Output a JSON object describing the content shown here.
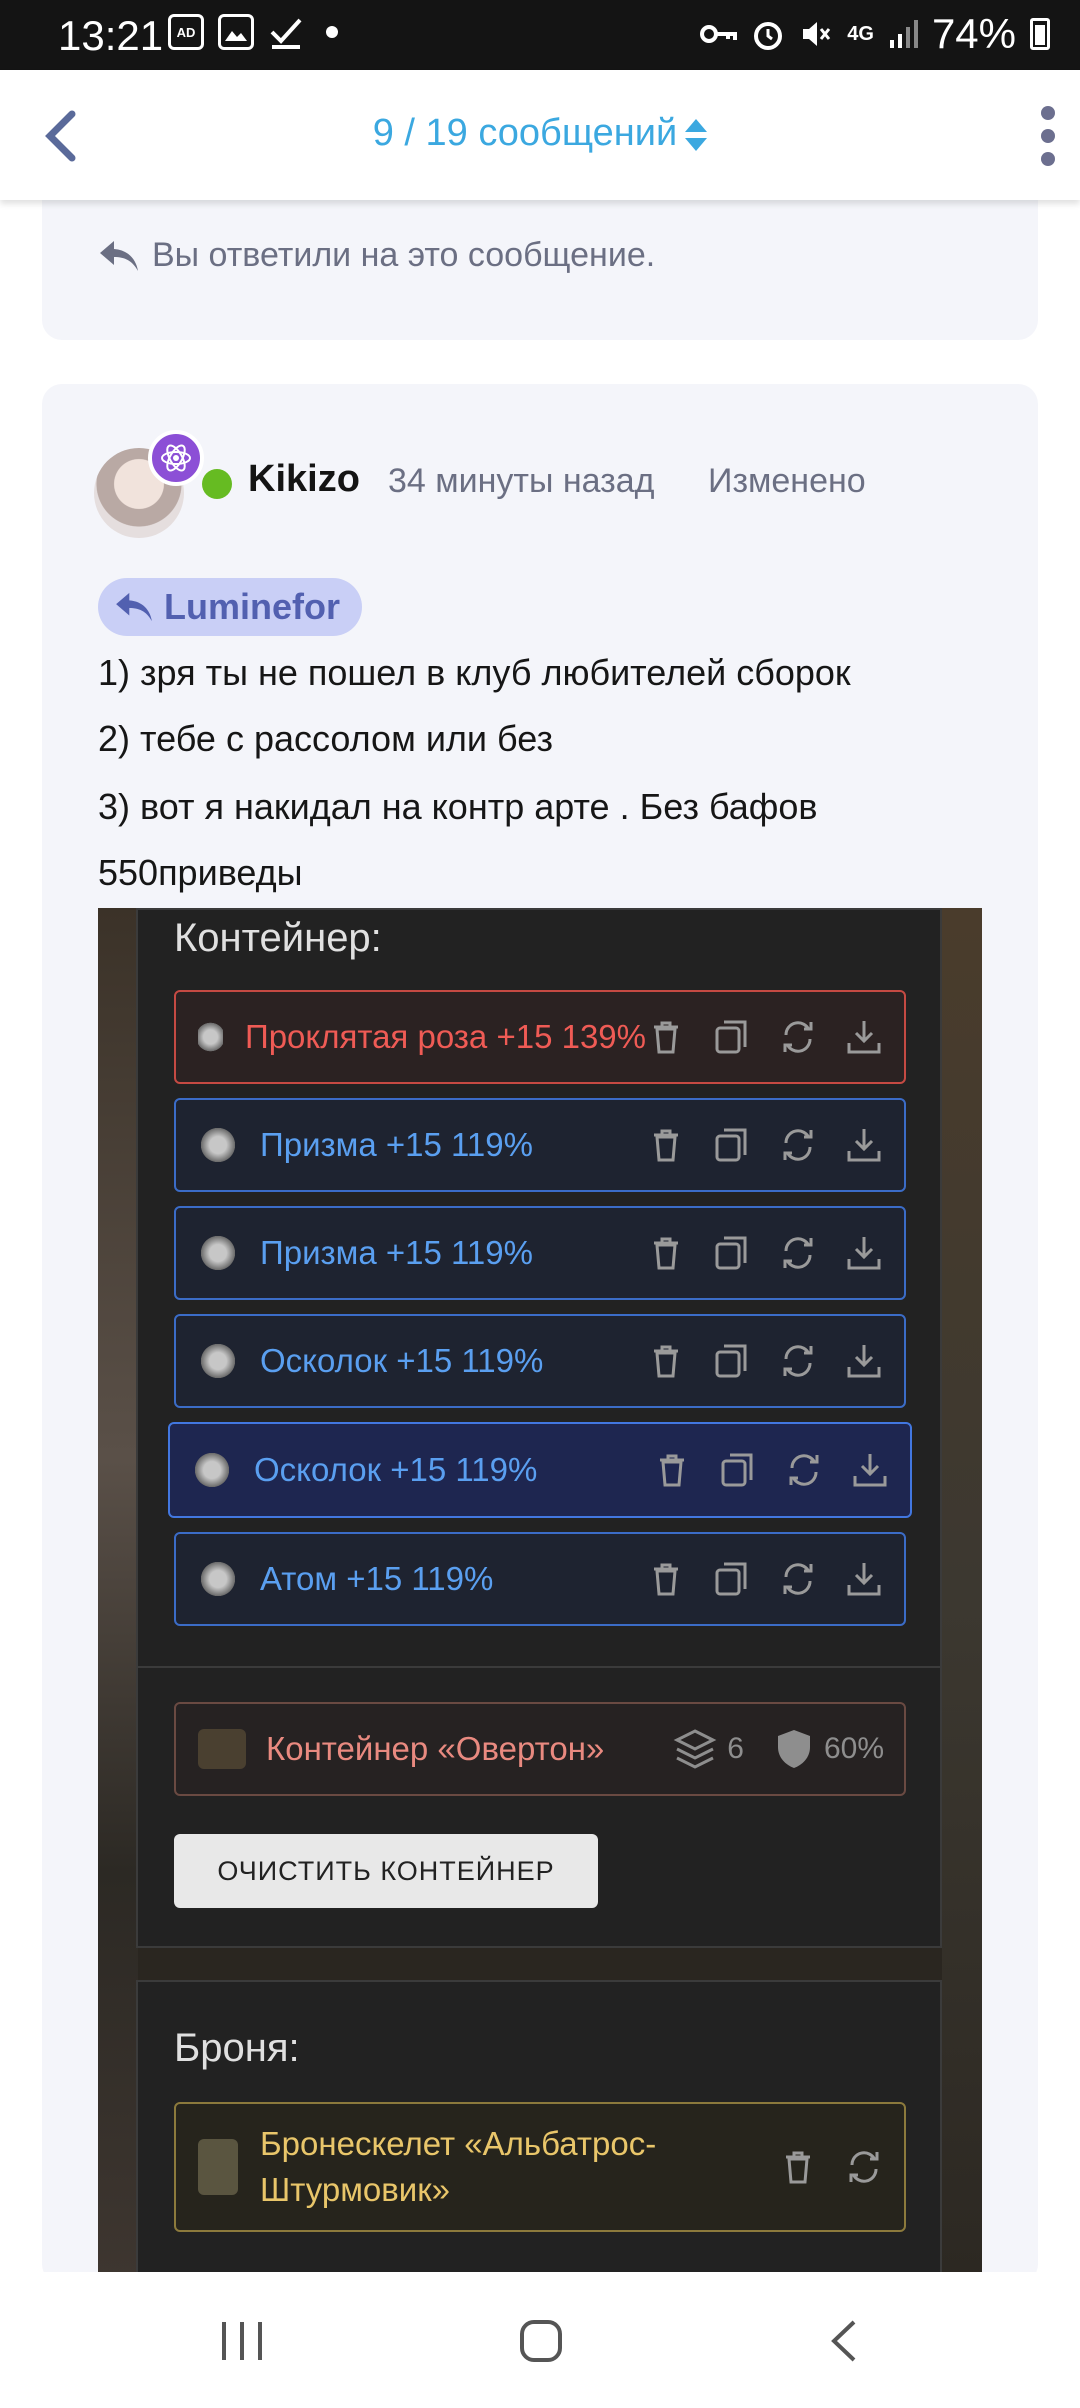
{
  "status_bar": {
    "time": "13:21",
    "notif_icons": [
      "ad-blocker-icon",
      "gallery-icon",
      "task-done-icon"
    ],
    "ad_badge": "AD",
    "battery": "74%",
    "network": "4G"
  },
  "header": {
    "title": "9 / 19 сообщений",
    "back_icon": "chevron-left-icon",
    "menu_icon": "more-vertical-icon",
    "accent_color": "#3ba8e0"
  },
  "previous_message": {
    "replied_text": "Вы ответили на это сообщение."
  },
  "message": {
    "author": "Kikizo",
    "time_ago": "34 минуты назад",
    "edited": "Изменено",
    "online_color": "#66bb22",
    "badge_icon": "atom-icon",
    "quote_author": "Luminefor",
    "lines": [
      "1) зря ты не пошел в клуб любителей сборок",
      "2) тебе с рассолом или без",
      "3) вот я накидал на контр арте . Без бафов",
      "550приведы"
    ]
  },
  "screenshot": {
    "container_title": "Контейнер:",
    "items": [
      {
        "label": "Проклятая роза +15 139%",
        "style": "red"
      },
      {
        "label": "Призма +15 119%",
        "style": "blue"
      },
      {
        "label": "Призма +15 119%",
        "style": "blue"
      },
      {
        "label": "Осколок +15 119%",
        "style": "blue"
      },
      {
        "label": "Осколок +15 119%",
        "style": "selected"
      },
      {
        "label": "Атом +15 119%",
        "style": "blue"
      }
    ],
    "box": {
      "label": "Контейнер «Овертон»",
      "slots": "6",
      "protection": "60%"
    },
    "clear_button": "ОЧИСТИТЬ КОНТЕЙНЕР",
    "armor_title": "Броня:",
    "armor_label_line1": "Бронескелет «Альбатрос-",
    "armor_label_line2": "Штурмовик»"
  }
}
